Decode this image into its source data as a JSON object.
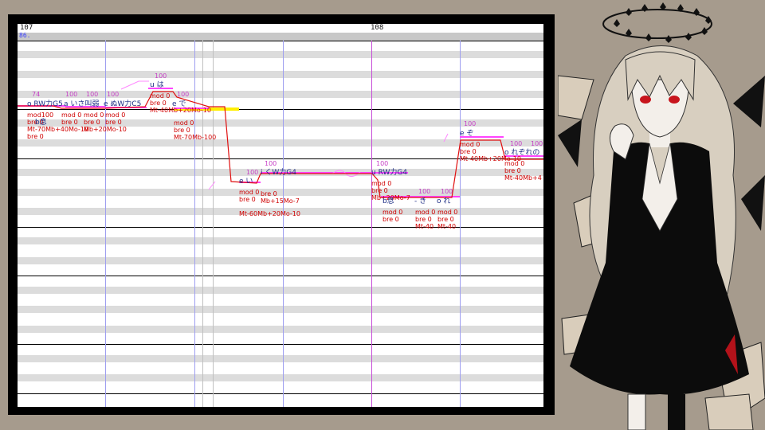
{
  "editor": {
    "measures": [
      {
        "label": "107"
      },
      {
        "label": "108"
      }
    ],
    "tempo": "86.",
    "colors": {
      "note_line": "#ff44ff",
      "pitch_curve": "#e01010",
      "lyric_text": "#1d2d85",
      "velocity_text": "#c640c6",
      "param_text": "#d00000",
      "highlight": "#ffee00",
      "bar_line": "#c84ed8",
      "beat_line": "#9e9ef0"
    },
    "notes": [
      {
        "lyric": "o RW力G5",
        "velocity": "74",
        "params": [
          "mod100",
          "bre 0",
          "Mt-70Mb+40Mo-10",
          "bre 0"
        ]
      },
      {
        "lyric": "b息",
        "velocity": "",
        "params": []
      },
      {
        "lyric": "a いさ叫弱",
        "velocity": "100",
        "params": [
          "mod 0",
          "bre 0"
        ]
      },
      {
        "lyric": "e ぬW力C5",
        "velocity": "100",
        "params": [
          "mod 0",
          "bre 0",
          "Mb+20Mo-10"
        ]
      },
      {
        "lyric": "",
        "velocity": "100",
        "params": [
          "mod 0",
          "bre 0"
        ]
      },
      {
        "lyric": "u は",
        "velocity": "100",
        "params": [
          "mod 0",
          "bre 0",
          "Mt-40Mb+20Mo-10"
        ]
      },
      {
        "lyric": "e で",
        "velocity": "100",
        "params": [
          "mod 0",
          "bre 0",
          "Mt-70Mb-100"
        ]
      },
      {
        "lyric": "e い",
        "velocity": "100",
        "params": [
          "mod 0",
          "bre 0",
          "Mt-60Mb+20Mo-10"
        ]
      },
      {
        "lyric": "i くW力G4",
        "velocity": "100",
        "params": [
          "bre 0",
          "Mb+15Mo-7"
        ]
      },
      {
        "lyric": "u RW力G4",
        "velocity": "100",
        "params": [
          "mod 0",
          "bre 0",
          "Mb+20Mo-7"
        ]
      },
      {
        "lyric": "b息",
        "velocity": "",
        "params": [
          "mod 0",
          "bre 0"
        ]
      },
      {
        "lyric": "- き",
        "velocity": "100",
        "params": [
          "mod 0",
          "bre 0",
          "Mt-40"
        ]
      },
      {
        "lyric": "o れ",
        "velocity": "100",
        "params": [
          "mod 0",
          "bre 0",
          "Mt-40"
        ]
      },
      {
        "lyric": "e ぞ",
        "velocity": "100",
        "params": [
          "mod 0",
          "bre 0",
          "Mt-40Mb+20Mo-10"
        ]
      },
      {
        "lyric": "o れぞれの",
        "velocity": "100",
        "params": [
          "mod 0",
          "bre 0",
          "Mt-40Mb+4"
        ]
      },
      {
        "lyric": "",
        "velocity": "100",
        "params": []
      }
    ]
  },
  "character": {
    "description_icon": "character-illustration",
    "colors": {
      "hair": "#d8cfc0",
      "coat": "#0c0c0c",
      "skin": "#f3efea",
      "eyes": "#c8151d",
      "background": "#a69b8d"
    }
  }
}
